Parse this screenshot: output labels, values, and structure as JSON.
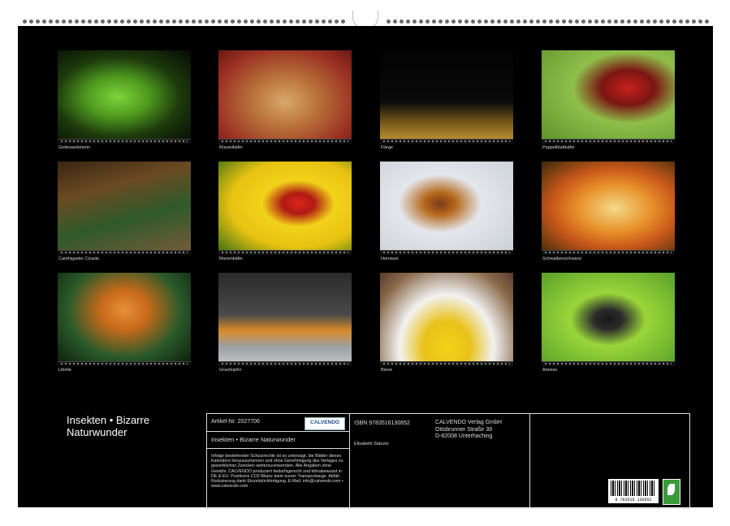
{
  "photos": [
    {
      "caption": "Gottesanbeterin",
      "bg": "radial-gradient(ellipse at 45% 50%, #7ed43a 0%, #4f9a1f 30%, #1d3a0c 60%, #050a03 100%)"
    },
    {
      "caption": "Rüsselkäfer",
      "bg": "radial-gradient(ellipse at 50% 55%, #d9a86a 0%, #b9723a 35%, #9a2f23 75%, #6a1a14 100%)"
    },
    {
      "caption": "Fliege",
      "bg": "linear-gradient(180deg, #020202 0%, #0a0a0a 55%, #7a5a1a 78%, #c79a3a 100%)"
    },
    {
      "caption": "Pappelblattkäfer",
      "bg": "radial-gradient(ellipse at 65% 40%, #c8201c 0%, #7a1612 22%, #8fbf4a 45%, #5c8f2a 100%)"
    },
    {
      "caption": "Canthigaster Cicada",
      "bg": "linear-gradient(165deg, #3a2612 0%, #6b4a22 30%, #2f5a2a 60%, #7a5a3a 100%)"
    },
    {
      "caption": "Marienkäfer",
      "bg": "radial-gradient(ellipse at 60% 45%, #d8261c 0%, #b01a12 14%, #f2d21a 32%, #e8c212 60%, #2c6a14 100%)"
    },
    {
      "caption": "Hornisse",
      "bg": "radial-gradient(ellipse at 45% 45%, #7a3a1a 0%, #b5671a 15%, #e4e7ec 40%, #c9ced6 100%)"
    },
    {
      "caption": "Schwalbenschwanz",
      "bg": "radial-gradient(ellipse at 55% 50%, #f3d98a 0%, #e8922a 35%, #c9581a 60%, #3a2a0a 100%)"
    },
    {
      "caption": "Libelle",
      "bg": "radial-gradient(ellipse at 50% 40%, #e6903a 0%, #c86a1a 25%, #2a5a2a 60%, #0a1a0a 100%)"
    },
    {
      "caption": "Grashüpfer",
      "bg": "linear-gradient(180deg, #2a2a2a 0%, #4a4a4a 45%, #d88a2a 62%, #9aa0a6 80%, #c9c9c9 100%)"
    },
    {
      "caption": "Biene",
      "bg": "radial-gradient(ellipse at 50% 80%, #f4d21a 0%, #e9c21a 25%, #f2f2f2 50%, #8a6a4a 80%, #5a3a2a 100%)"
    },
    {
      "caption": "Ameise",
      "bg": "radial-gradient(ellipse at 50% 50%, #1a1a1a 0%, #2a2a2a 15%, #9ad63a 40%, #5aa02a 100%)"
    }
  ],
  "title": "Insekten • Bizarre Naturwunder",
  "info": {
    "artikel": "Artikel-Nr. 2027706",
    "logo": "CALVENDO",
    "subtitle": "Insekten • Bizarre Naturwunder",
    "legal": "Infolge bestehender Schutzrechte ist es untersagt, die Blätter dieses Kalenders herauszutrennen und ohne Genehmigung des Verlages zu gewerblichen Zwecken weiterzuverwenden. Alle Angaben ohne Gewähr. CALVENDO produziert bedarfsgerecht und klimabewusst in DE & EU. Positivere CO2-Bilanz dank kurzer Transportwege. Abfall-Reduzierung dank Einzelstückfertigung. E-Mail: info@calvendo.com • www.calvendo.com",
    "isbn": "ISBN 9783516130652",
    "author": "Elisabeth Stanzer",
    "publisher_1": "CALVENDO Verlag GmbH",
    "publisher_2": "Ottobrunner Straße 39",
    "publisher_3": "D-82008 Unterhaching",
    "barcode_number": "9 783516 130652"
  },
  "colors": {
    "sheet": "#000000",
    "text": "#ffffff",
    "rule": "#dddddd"
  }
}
